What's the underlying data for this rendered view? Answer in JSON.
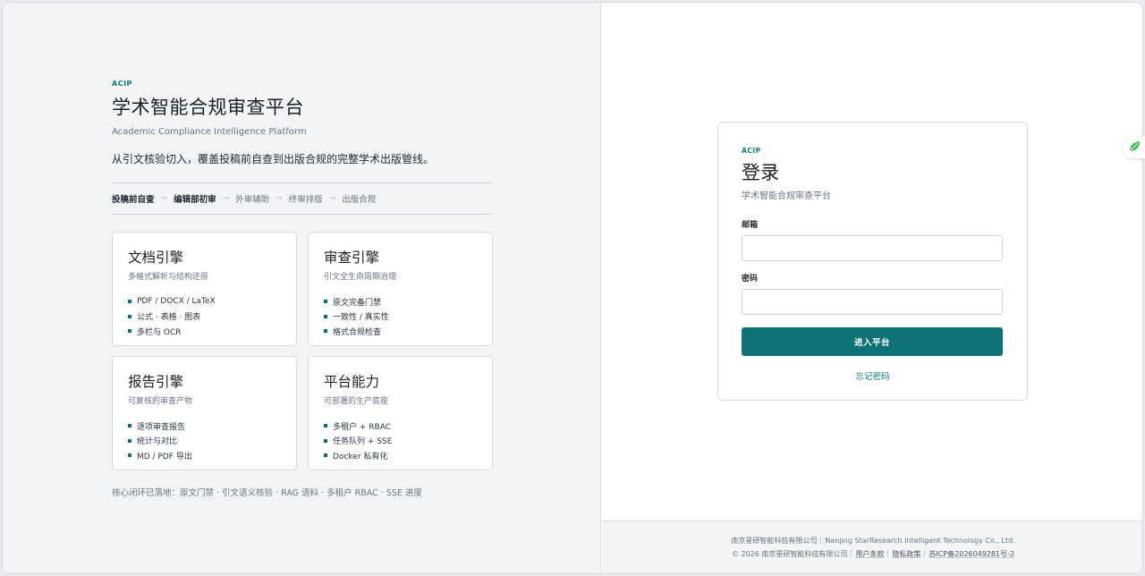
{
  "brand": {
    "eyebrow": "ACIP",
    "title": "学术智能合规审查平台",
    "subtitle": "Academic Compliance Intelligence Platform",
    "tagline": "从引文核验切入，覆盖投稿前自查到出版合规的完整学术出版管线。"
  },
  "pipeline": [
    "投稿前自查",
    "编辑部初审",
    "外审辅助",
    "终审排版",
    "出版合规"
  ],
  "pipeline_arrow": "→",
  "cards": [
    {
      "title": "文档引擎",
      "subtitle": "多格式解析与结构还原",
      "items": [
        "PDF / DOCX / LaTeX",
        "公式 · 表格 · 图表",
        "多栏与 OCR"
      ]
    },
    {
      "title": "审查引擎",
      "subtitle": "引文全生命周期治理",
      "items": [
        "原文完备门禁",
        "一致性 / 真实性",
        "格式合规检查"
      ]
    },
    {
      "title": "报告引擎",
      "subtitle": "可复核的审查产物",
      "items": [
        "逐项审查报告",
        "统计与对比",
        "MD / PDF 导出"
      ]
    },
    {
      "title": "平台能力",
      "subtitle": "可部署的生产底座",
      "items": [
        "多租户 + RBAC",
        "任务队列 + SSE",
        "Docker 私有化"
      ]
    }
  ],
  "footnote": "核心闭环已落地：原文门禁 · 引文语义核验 · RAG 语料 · 多租户 RBAC · SSE 进度",
  "login": {
    "eyebrow": "ACIP",
    "title": "登录",
    "subtitle": "学术智能合规审查平台",
    "email_label": "邮箱",
    "email_value": "",
    "password_label": "密码",
    "password_value": "",
    "submit_label": "进入平台",
    "forgot_label": "忘记密码"
  },
  "footer": {
    "company_cn": "南京星研智能科技有限公司",
    "company_en": "Nanjing StarResearch Intelligent Technology Co., Ltd.",
    "copyright": "© 2026 南京星研智能科技有限公司",
    "terms": "用户条款",
    "privacy": "隐私政策",
    "icp": "苏ICP备2026049281号-2"
  },
  "colors": {
    "accent": "#0f7278",
    "left_bg": "#f3f4f6",
    "leaf": "#3cc15a"
  },
  "icons": {
    "float_button": "leaf-icon"
  }
}
